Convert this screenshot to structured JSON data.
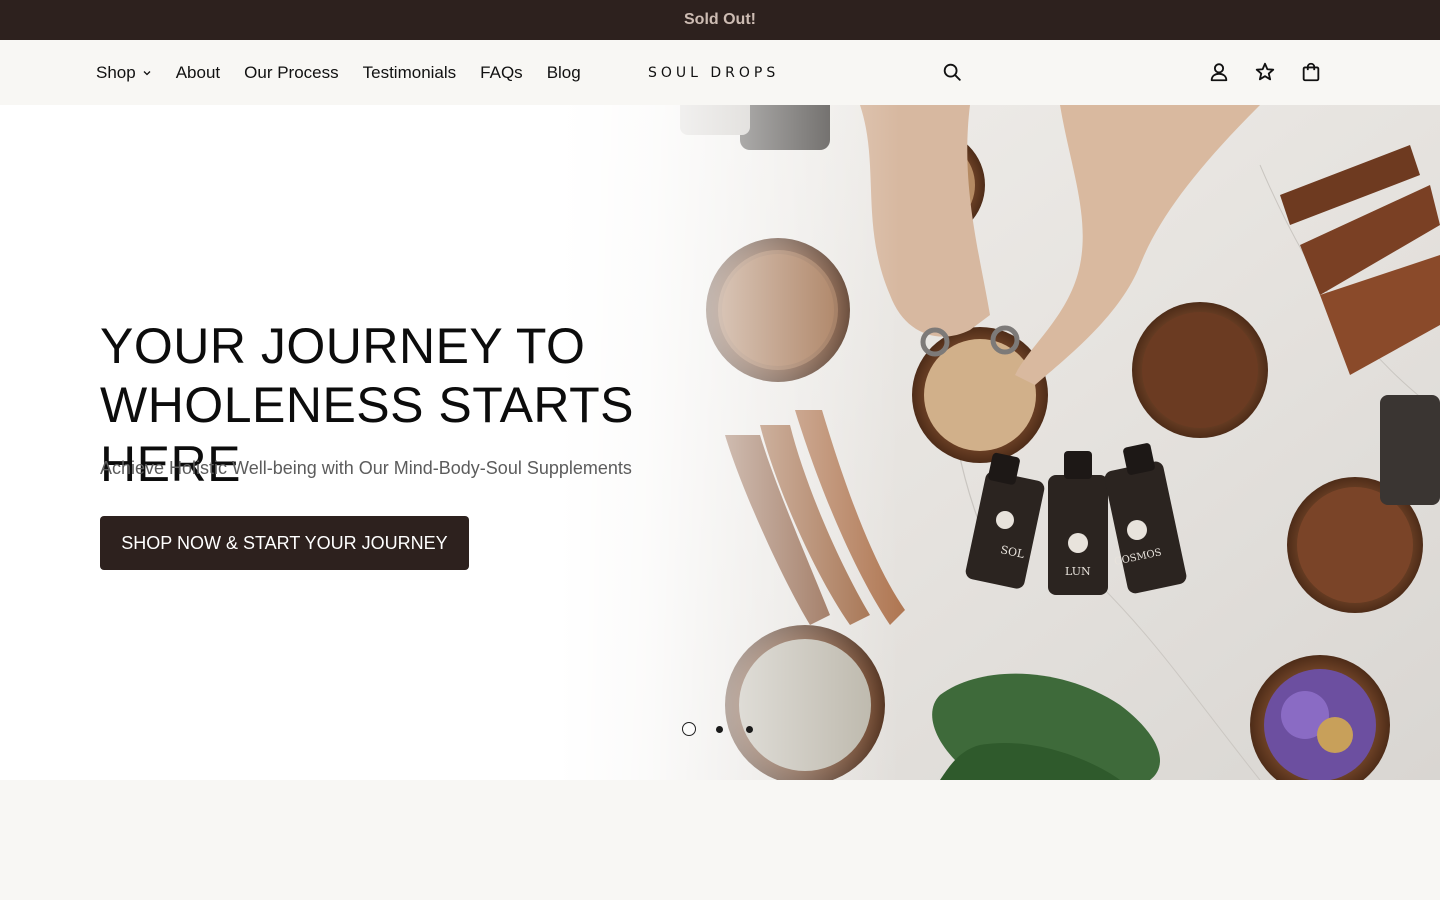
{
  "announcement": {
    "text": "Sold Out!"
  },
  "nav": {
    "items": [
      {
        "label": "Shop",
        "has_dropdown": true
      },
      {
        "label": "About"
      },
      {
        "label": "Our Process"
      },
      {
        "label": "Testimonials"
      },
      {
        "label": "FAQs"
      },
      {
        "label": "Blog"
      }
    ]
  },
  "logo": {
    "text": "SOUL DROPS"
  },
  "header_icons": [
    "search-icon",
    "account-icon",
    "wishlist-star-icon",
    "cart-bag-icon"
  ],
  "hero": {
    "headline_line1": "YOUR JOURNEY TO",
    "headline_line2": "WHOLENESS STARTS HERE",
    "subheadline": "Achieve Holistic Well-being with Our Mind-Body-Soul Supplements",
    "cta_label": "SHOP NOW & START YOUR JOURNEY",
    "slide_count": 3,
    "active_slide": 1,
    "bottle_labels": [
      "SOL",
      "LUN",
      "COSMOS"
    ]
  },
  "colors": {
    "announcement_bg": "#2d211e",
    "announcement_text": "#cdbcb3",
    "cta_bg": "#2d211e",
    "page_bg": "#f8f7f4"
  }
}
